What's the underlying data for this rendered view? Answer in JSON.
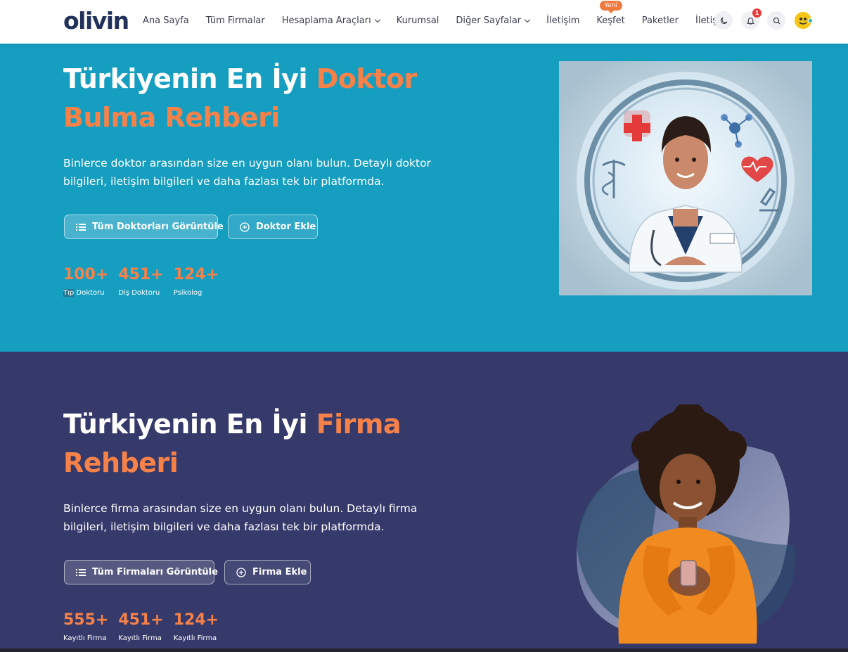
{
  "nav": {
    "logo": "olivin",
    "items": [
      {
        "label": "Ana Sayfa"
      },
      {
        "label": "Tüm Firmalar"
      },
      {
        "label": "Hesaplama Araçları",
        "dropdown": true
      },
      {
        "label": "Kurumsal"
      },
      {
        "label": "Diğer Sayfalar",
        "dropdown": true
      },
      {
        "label": "İletişim"
      },
      {
        "label": "Keşfet",
        "badge": "Yeni"
      },
      {
        "label": "Paketler"
      },
      {
        "label": "İletişim"
      }
    ],
    "notification_count": "1",
    "icons": [
      "moon-icon",
      "bell-icon",
      "search-icon",
      "avatar"
    ]
  },
  "hero_doctor": {
    "title_white": "Türkiyenin En İyi ",
    "title_accent_1": "Doktor",
    "title_accent_2": "Bulma Rehberi",
    "description_line1": "Binlerce doktor arasından size en uygun olanı bulun. Detaylı doktor",
    "description_line2": "bilgileri, iletişim bilgileri ve daha fazlası tek bir platformda.",
    "btn_primary": "Tüm Doktorları Görüntüle",
    "btn_secondary": "Doktor Ekle",
    "stats": [
      {
        "value": "100+",
        "label_hl": "Tıp",
        "label": " Doktoru"
      },
      {
        "value": "451+",
        "label": "Diş Doktoru"
      },
      {
        "value": "124+",
        "label": "Psikolog"
      }
    ]
  },
  "hero_firm": {
    "title_white": "Türkiyenin En İyi ",
    "title_accent_1": "Firma",
    "title_accent_2": "Rehberi",
    "description_line1": "Binlerce firma arasından size en uygun olanı bulun. Detaylı firma",
    "description_line2": "bilgileri, iletişim bilgileri ve daha fazlası tek bir platformda.",
    "btn_primary": "Tüm Firmaları Görüntüle",
    "btn_secondary": "Firma Ekle",
    "stats": [
      {
        "value": "555+",
        "label": "Kayıtlı Firma"
      },
      {
        "value": "451+",
        "label": "Kayıtlı Firma"
      },
      {
        "value": "124+",
        "label": "Kayıtlı Firma"
      }
    ]
  },
  "colors": {
    "hero_doctor_bg": "#169ec1",
    "hero_firm_bg": "#363a6b",
    "accent": "#f6824a",
    "logo": "#22315a"
  }
}
